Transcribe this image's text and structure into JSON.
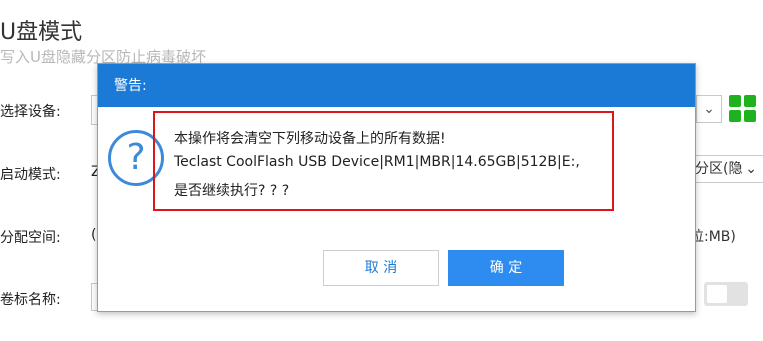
{
  "background": {
    "title": "U盘模式",
    "subtitle": "写入U盘隐藏分区防止病毒破坏",
    "labels": {
      "select_device": "选择设备:",
      "boot_mode": "启动模式:",
      "allocate_space": "分配空间:",
      "volume_name": "卷标名称:"
    },
    "boot_mode_value_partial": "Z",
    "allocate_radio_partial": "(",
    "right_select_partial": "分区(隐",
    "unit_text_partial": "位:MB)",
    "chevron": "⌄"
  },
  "dialog": {
    "title": "警告:",
    "icon_glyph": "?",
    "message": {
      "line1": "本操作将会清空下列移动设备上的所有数据!",
      "line2": "Teclast CoolFlash USB Device|RM1|MBR|14.65GB|512B|E:,",
      "line3": "是否继续执行? ? ?"
    },
    "cancel_label": "取 消",
    "ok_label": "确 定"
  },
  "colors": {
    "dialog_header": "#1b7ad6",
    "highlight_border": "#d9161c",
    "primary_button": "#2e8cf0",
    "grid_icon": "#1fb21f"
  }
}
